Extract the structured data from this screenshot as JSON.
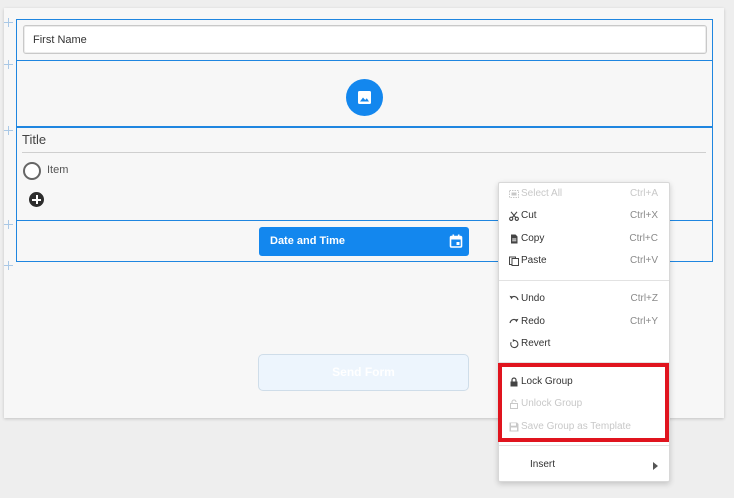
{
  "form": {
    "first_name_value": "First Name",
    "image_field_icon": "image-icon",
    "radio_group": {
      "title": "Title",
      "items": [
        "Item"
      ]
    },
    "date_time_label": "Date and Time",
    "date_time_icon": "calendar-icon",
    "send_label": "Send Form"
  },
  "context_menu": {
    "items": [
      {
        "label": "Select All",
        "shortcut": "Ctrl+A",
        "icon": "select-all-icon",
        "enabled": false
      },
      {
        "label": "Cut",
        "shortcut": "Ctrl+X",
        "icon": "scissors-icon",
        "enabled": true
      },
      {
        "label": "Copy",
        "shortcut": "Ctrl+C",
        "icon": "copy-icon",
        "enabled": true
      },
      {
        "label": "Paste",
        "shortcut": "Ctrl+V",
        "icon": "paste-icon",
        "enabled": true
      },
      {
        "label": "Undo",
        "shortcut": "Ctrl+Z",
        "icon": "undo-icon",
        "enabled": true
      },
      {
        "label": "Redo",
        "shortcut": "Ctrl+Y",
        "icon": "redo-icon",
        "enabled": true
      },
      {
        "label": "Revert",
        "shortcut": "",
        "icon": "revert-icon",
        "enabled": true
      },
      {
        "label": "Lock Group",
        "shortcut": "",
        "icon": "lock-icon",
        "enabled": true
      },
      {
        "label": "Unlock Group",
        "shortcut": "",
        "icon": "unlock-icon",
        "enabled": false
      },
      {
        "label": "Save Group as Template",
        "shortcut": "",
        "icon": "save-icon",
        "enabled": false
      },
      {
        "label": "Insert",
        "shortcut": "",
        "icon": "",
        "enabled": true
      }
    ]
  },
  "colors": {
    "accent": "#1387ee",
    "highlight": "#e0141e"
  }
}
